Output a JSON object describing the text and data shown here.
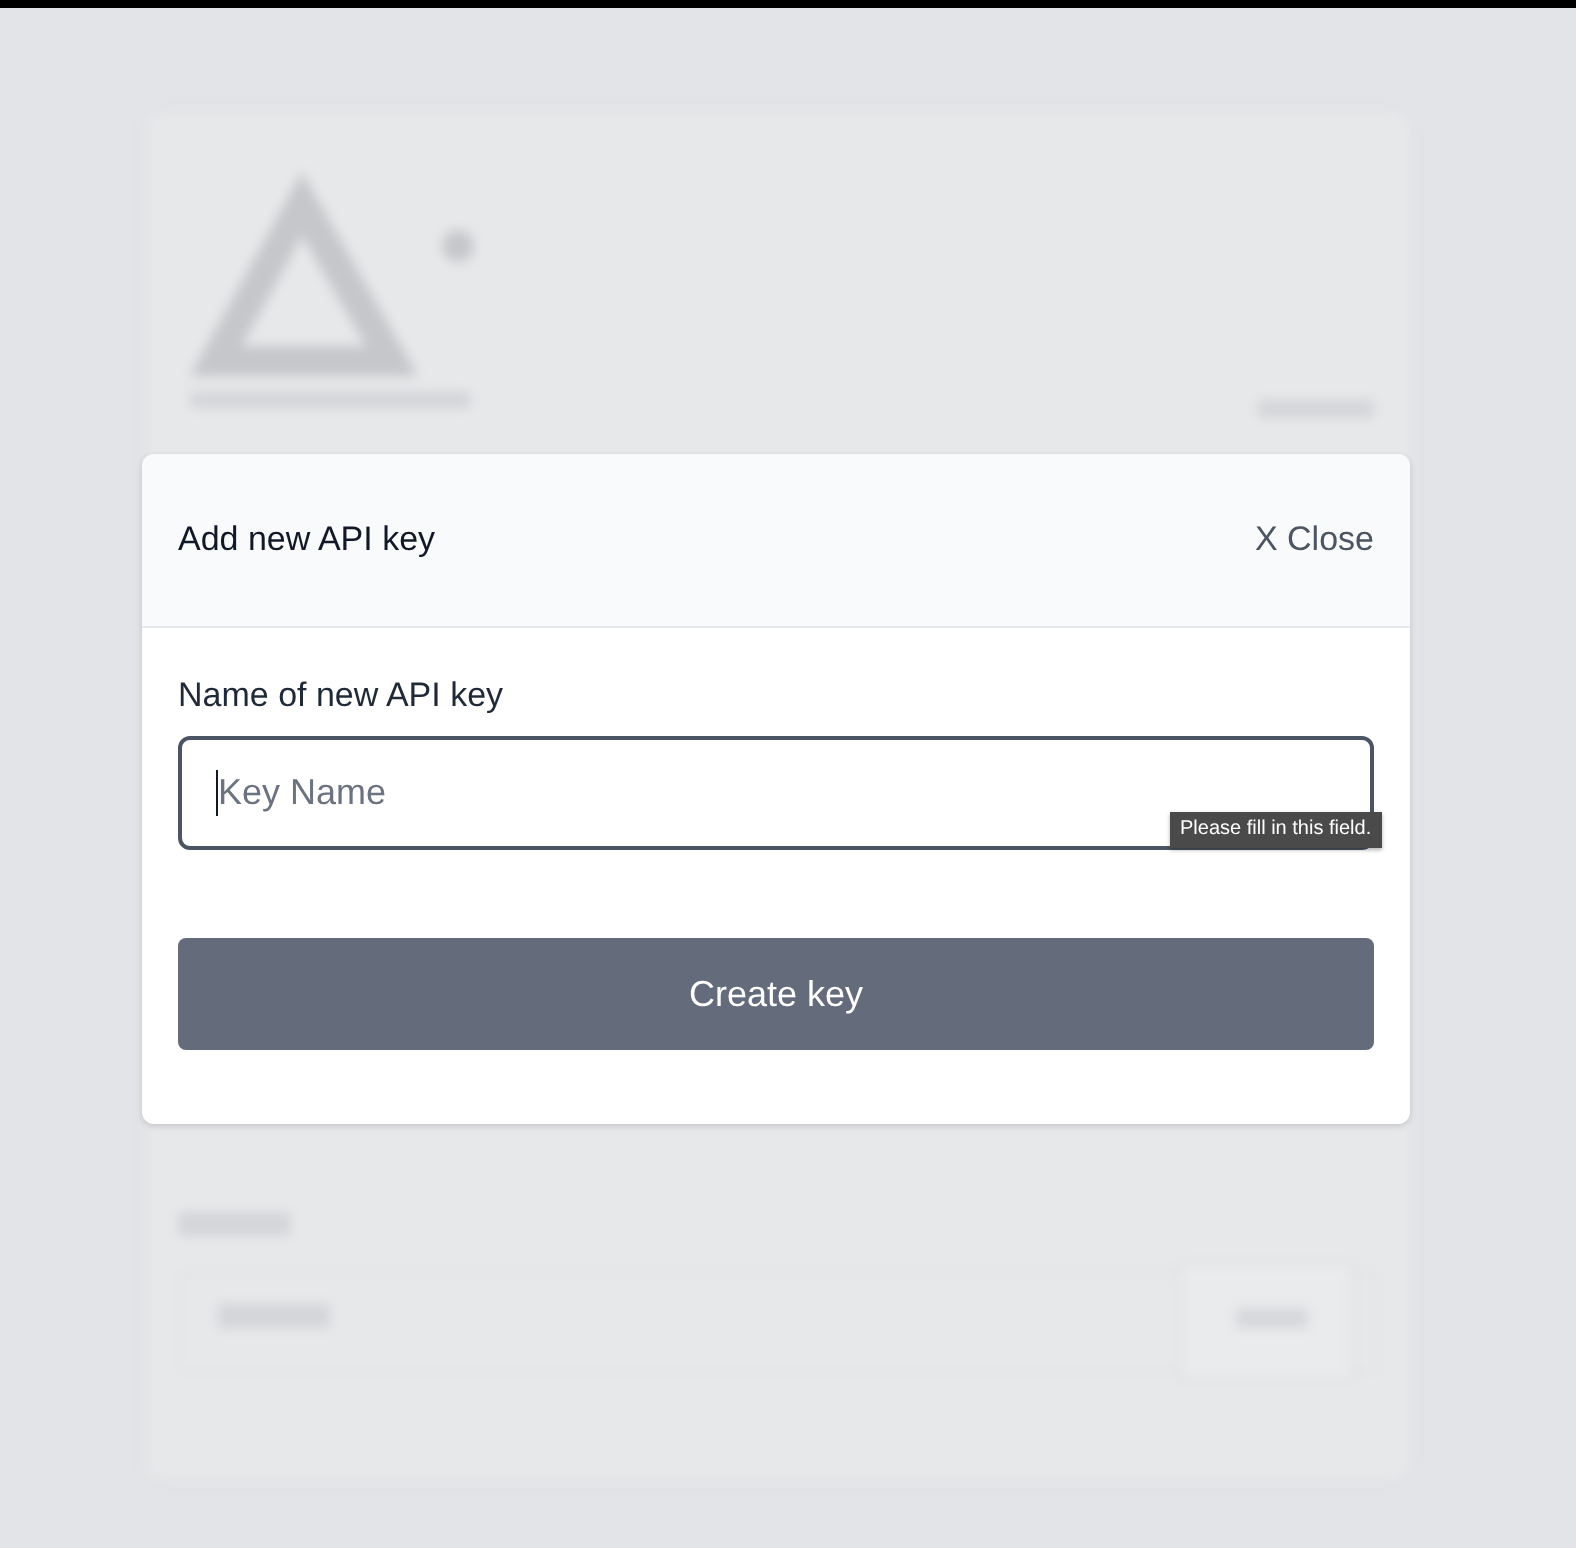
{
  "modal": {
    "title": "Add new API key",
    "close_button": "X Close",
    "field": {
      "label": "Name of new API key",
      "placeholder": "Key Name",
      "focused": true
    },
    "tooltip": "Please fill in this field.",
    "submit_button": "Create key"
  }
}
